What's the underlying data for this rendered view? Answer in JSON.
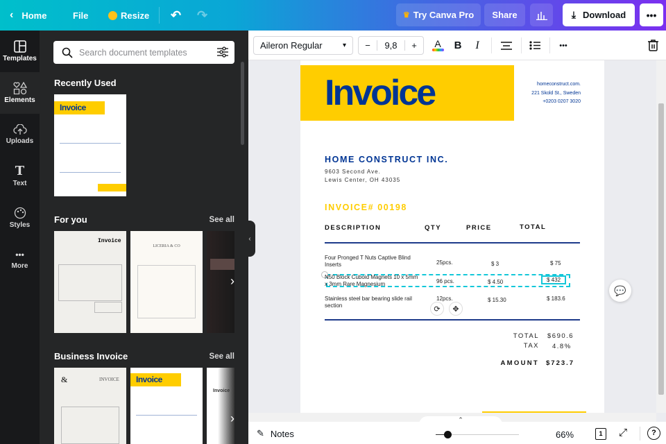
{
  "topbar": {
    "home": "Home",
    "file": "File",
    "resize": "Resize",
    "try_pro": "Try Canva Pro",
    "share": "Share",
    "download": "Download"
  },
  "rail": [
    {
      "label": "Templates"
    },
    {
      "label": "Elements"
    },
    {
      "label": "Uploads"
    },
    {
      "label": "Text"
    },
    {
      "label": "Styles"
    },
    {
      "label": "More"
    }
  ],
  "panel": {
    "search_placeholder": "Search document templates",
    "recently_used": "Recently Used",
    "for_you": "For you",
    "business_invoice": "Business Invoice",
    "see_all": "See all",
    "thumbs": {
      "invoice": "Invoice",
      "liceria": "LICERIA & CO",
      "invoice_caps": "INVOICE"
    }
  },
  "toolbar": {
    "font": "Aileron Regular",
    "font_size": "9,8",
    "minus": "−",
    "plus": "+"
  },
  "doc": {
    "title": "Invoice",
    "contact": [
      "homeconstruct.com.",
      "221 Skold St., Sweden",
      "+0203 0207 3020"
    ],
    "company": "HOME CONSTRUCT INC.",
    "address": [
      "9603 Second Ave.",
      "Lewis Center, OH 43035"
    ],
    "invoice_no": "INVOICE# 00198",
    "headers": [
      "DESCRIPTION",
      "QTY",
      "PRICE",
      "TOTAL"
    ],
    "rows": [
      {
        "desc": "Four Pronged T Nuts Captive Blind Inserts",
        "qty": "25pcs.",
        "price": "$ 3",
        "total": "$ 75"
      },
      {
        "desc": "N50 Block Cuboid Magnets 10 x 5mm x 3mm Rare Magnesium",
        "qty": "96 pcs.",
        "price": "$ 4.50",
        "total": "$ 432"
      },
      {
        "desc": "Stainless steel bar bearing slide rail section",
        "qty": "12pcs.",
        "price": "$ 15.30",
        "total": "$ 183.6"
      }
    ],
    "total_label": "TOTAL",
    "total": "$690.6",
    "tax_label": "TAX",
    "tax": "4.8%",
    "amount_label": "AMOUNT",
    "amount": "$723.7"
  },
  "bottom": {
    "notes": "Notes",
    "zoom": "66%",
    "page": "1",
    "zoom_fraction": 0.1
  },
  "colors": {
    "yellow": "#ffcd00",
    "navy": "#003594"
  }
}
